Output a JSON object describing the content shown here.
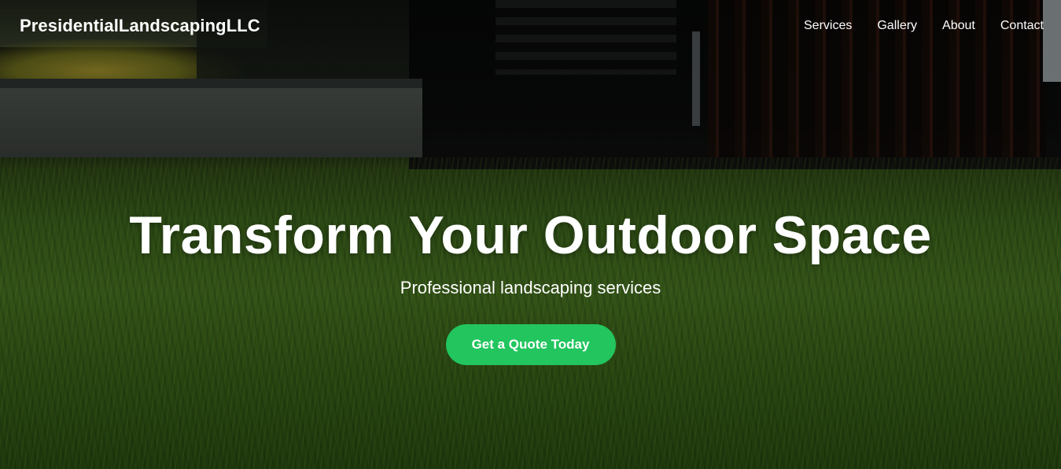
{
  "brand": {
    "name": "PresidentialLandscapingLLC"
  },
  "nav": {
    "items": [
      {
        "label": "Services"
      },
      {
        "label": "Gallery"
      },
      {
        "label": "About"
      },
      {
        "label": "Contact"
      }
    ]
  },
  "hero": {
    "title": "Transform Your Outdoor Space",
    "subtitle": "Professional landscaping services",
    "cta_label": "Get a Quote Today"
  },
  "colors": {
    "accent": "#22c55e",
    "text": "#ffffff"
  }
}
